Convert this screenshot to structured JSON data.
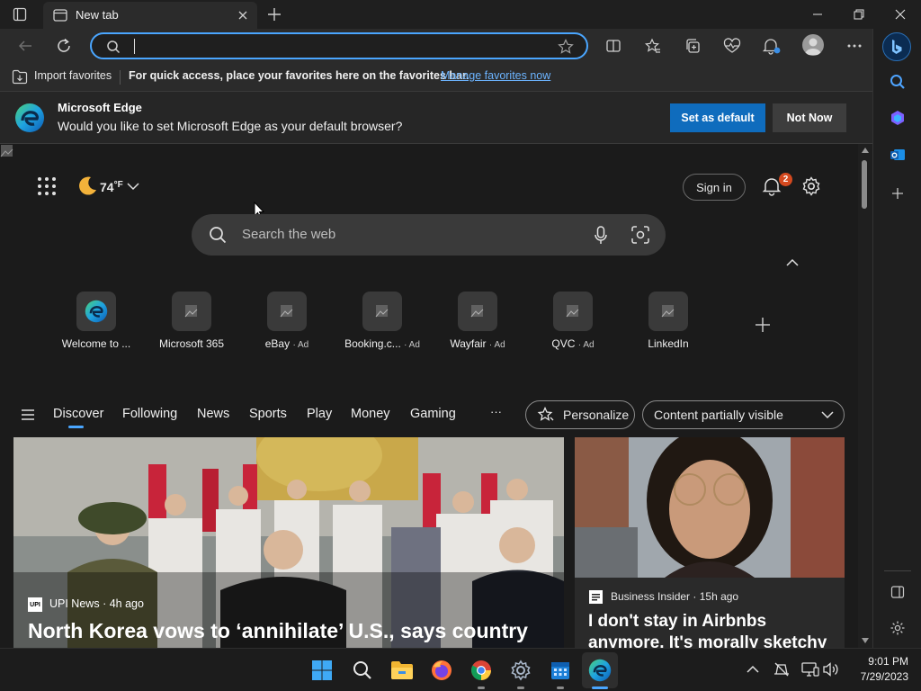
{
  "tab": {
    "title": "New tab"
  },
  "address": {
    "placeholder": ""
  },
  "favorites_bar": {
    "import_label": "Import favorites",
    "message": "For quick access, place your favorites here on the favorites bar.",
    "manage_link": "Manage favorites now"
  },
  "default_prompt": {
    "title": "Microsoft Edge",
    "message": "Would you like to set Microsoft Edge as your default browser?",
    "set_default": "Set as default",
    "not_now": "Not Now"
  },
  "page": {
    "weather": {
      "temp": "74",
      "unit": "°F"
    },
    "sign_in": "Sign in",
    "notification_count": "2",
    "search_placeholder": "Search the web",
    "quick_links": [
      {
        "label": "Welcome to ...",
        "ad": ""
      },
      {
        "label": "Microsoft 365",
        "ad": ""
      },
      {
        "label": "eBay",
        "ad": "· Ad"
      },
      {
        "label": "Booking.c...",
        "ad": "· Ad"
      },
      {
        "label": "Wayfair",
        "ad": "· Ad"
      },
      {
        "label": "QVC",
        "ad": "· Ad"
      },
      {
        "label": "LinkedIn",
        "ad": ""
      }
    ],
    "feed_nav": [
      "Discover",
      "Following",
      "News",
      "Sports",
      "Play",
      "Money",
      "Gaming"
    ],
    "more": "···",
    "personalize": "Personalize",
    "content_visibility": "Content partially visible",
    "main_story": {
      "source": "UPI News",
      "age": "· 4h ago",
      "headline": "North Korea vows to ‘annihilate’ U.S., says country"
    },
    "side_story": {
      "source": "Business Insider",
      "age": "· 15h ago",
      "headline_1": "I don't stay in Airbnbs",
      "headline_2": "anymore. It's morally sketchy"
    }
  },
  "clock": {
    "time": "9:01 PM",
    "date": "7/29/2023"
  },
  "colors": {
    "accent": "#0f6cbd",
    "focus": "#4aa6ff",
    "link": "#6cb4ff",
    "badge": "#d4491f"
  }
}
